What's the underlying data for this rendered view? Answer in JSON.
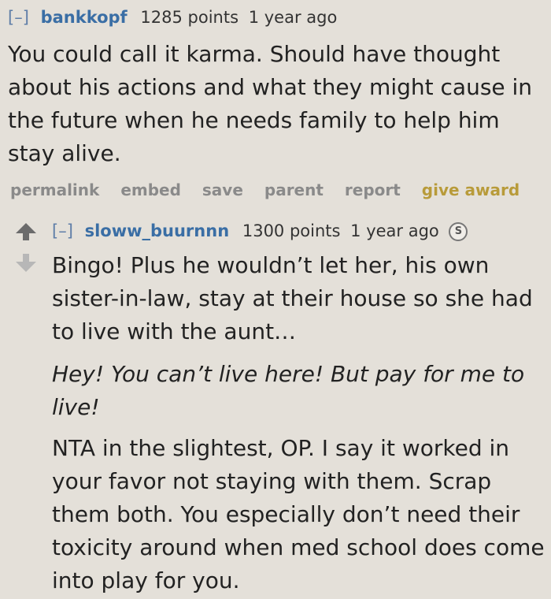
{
  "comment1": {
    "toggle": "[–]",
    "author": "bankkopf",
    "score": "1285 points",
    "time": "1 year ago",
    "body": "You could call it karma. Should have thought about his actions and what they might cause in the future when he needs family to help him stay alive.",
    "buttons": {
      "permalink": "permalink",
      "embed": "embed",
      "save": "save",
      "parent": "parent",
      "report": "report",
      "give_award": "give award"
    }
  },
  "comment2": {
    "toggle": "[–]",
    "author": "sloww_buurnnn",
    "score": "1300 points",
    "time": "1 year ago",
    "award_icon": "S",
    "paragraphs": [
      "Bingo! Plus he wouldn’t let her, his own sister-in-law, stay at their house so she had to live with the aunt…",
      "Hey! You can’t live here! But pay for me to live!",
      "NTA in the slightest, OP. I say it worked in your favor not staying with them. Scrap them both. You especially don’t need their toxicity around when med school does come into play for you."
    ]
  }
}
